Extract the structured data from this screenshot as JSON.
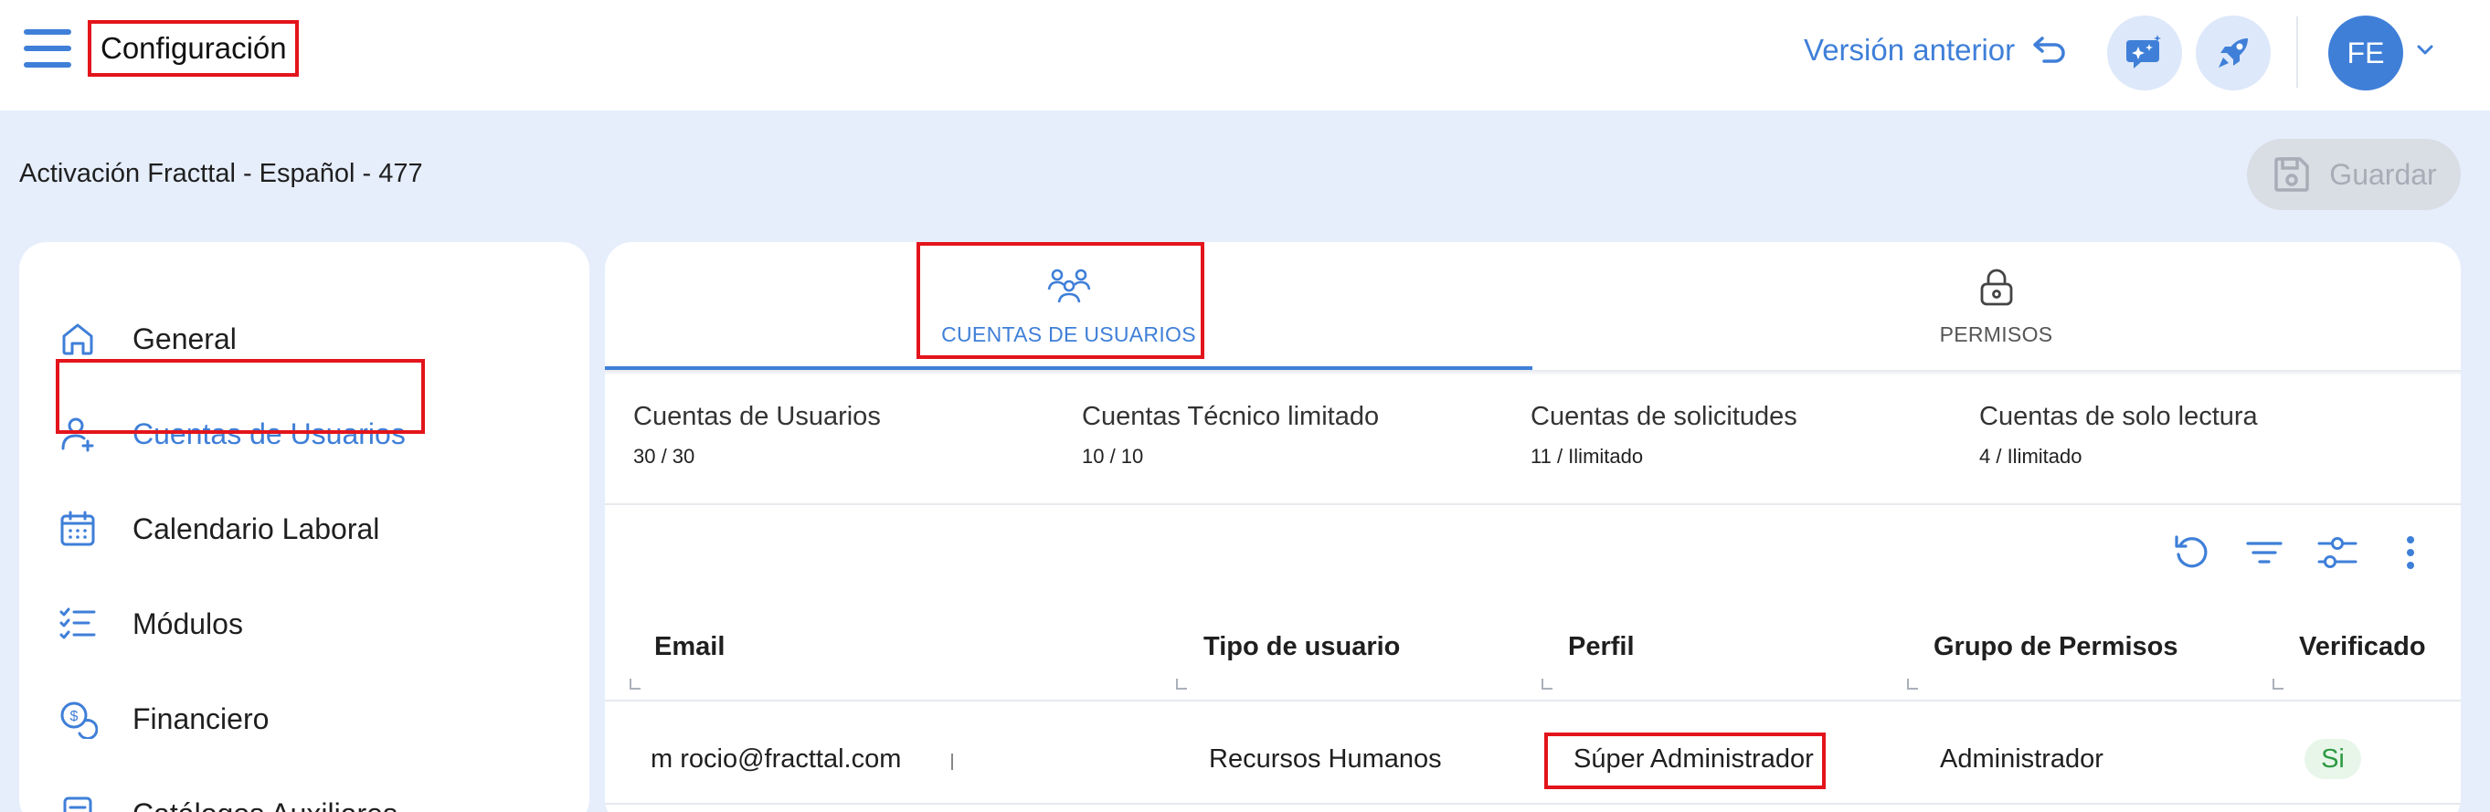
{
  "header": {
    "title": "Configuración",
    "previous_version": "Versión anterior",
    "avatar_initials": "FE"
  },
  "subheader": {
    "company": "Activación Fracttal - Español - 477",
    "save_label": "Guardar"
  },
  "sidebar": {
    "items": [
      {
        "label": "General",
        "icon": "home-icon"
      },
      {
        "label": "Cuentas de Usuarios",
        "icon": "user-add-icon",
        "active": true
      },
      {
        "label": "Calendario Laboral",
        "icon": "calendar-icon"
      },
      {
        "label": "Módulos",
        "icon": "checklist-icon"
      },
      {
        "label": "Financiero",
        "icon": "finance-icon"
      },
      {
        "label": "Catálogos Auxiliares",
        "icon": "catalog-icon"
      }
    ]
  },
  "tabs": [
    {
      "label": "CUENTAS DE USUARIOS",
      "icon": "users-group-icon",
      "active": true
    },
    {
      "label": "PERMISOS",
      "icon": "lock-icon",
      "active": false
    }
  ],
  "counts": [
    {
      "label": "Cuentas de Usuarios",
      "value": "30 / 30"
    },
    {
      "label": "Cuentas Técnico limitado",
      "value": "10 / 10"
    },
    {
      "label": "Cuentas de solicitudes",
      "value": "11 / Ilimitado"
    },
    {
      "label": "Cuentas de solo lectura",
      "value": "4 / Ilimitado"
    }
  ],
  "table": {
    "columns": [
      "Email",
      "Tipo de usuario",
      "Perfil",
      "Grupo de Permisos",
      "Verificado"
    ],
    "rows": [
      {
        "email": "m rocio@fracttal.com",
        "tipo": "Recursos Humanos",
        "perfil": "Súper Administrador",
        "grupo": "Administrador",
        "verificado": "Si"
      }
    ]
  },
  "colors": {
    "accent": "#3f7fd8",
    "highlight_box": "#e3141b",
    "background": "#e6eefc",
    "verified_green": "#2d9a42"
  }
}
